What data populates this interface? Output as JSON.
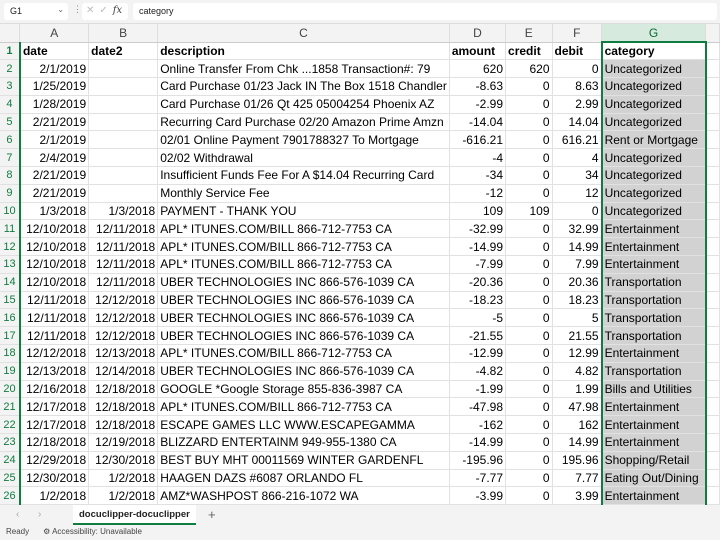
{
  "formula_bar": {
    "name_box": "G1",
    "formula": "category"
  },
  "columns": [
    "A",
    "B",
    "C",
    "D",
    "E",
    "F",
    "G"
  ],
  "rows": [
    [
      "date",
      "date2",
      "description",
      "amount",
      "credit",
      "debit",
      "category"
    ],
    [
      "2/1/2019",
      "",
      "Online Transfer From Chk ...1858 Transaction#: 79",
      "620",
      "620",
      "0",
      "Uncategorized"
    ],
    [
      "1/25/2019",
      "",
      "Card Purchase 01/23 Jack IN The Box 1518 Chandler",
      "-8.63",
      "0",
      "8.63",
      "Uncategorized"
    ],
    [
      "1/28/2019",
      "",
      "Card Purchase 01/26 Qt 425 05004254 Phoenix AZ",
      "-2.99",
      "0",
      "2.99",
      "Uncategorized"
    ],
    [
      "2/21/2019",
      "",
      "Recurring Card Purchase 02/20 Amazon Prime Amzn",
      "-14.04",
      "0",
      "14.04",
      "Uncategorized"
    ],
    [
      "2/1/2019",
      "",
      "02/01 Online Payment 7901788327 To Mortgage",
      "-616.21",
      "0",
      "616.21",
      "Rent or Mortgage"
    ],
    [
      "2/4/2019",
      "",
      "02/02 Withdrawal",
      "-4",
      "0",
      "4",
      "Uncategorized"
    ],
    [
      "2/21/2019",
      "",
      "Insufficient Funds Fee For A $14.04 Recurring Card",
      "-34",
      "0",
      "34",
      "Uncategorized"
    ],
    [
      "2/21/2019",
      "",
      "Monthly Service Fee",
      "-12",
      "0",
      "12",
      "Uncategorized"
    ],
    [
      "1/3/2018",
      "1/3/2018",
      "PAYMENT - THANK YOU",
      "109",
      "109",
      "0",
      "Uncategorized"
    ],
    [
      "12/10/2018",
      "12/11/2018",
      "APL* ITUNES.COM/BILL 866-712-7753 CA",
      "-32.99",
      "0",
      "32.99",
      "Entertainment"
    ],
    [
      "12/10/2018",
      "12/11/2018",
      "APL* ITUNES.COM/BILL 866-712-7753 CA",
      "-14.99",
      "0",
      "14.99",
      "Entertainment"
    ],
    [
      "12/10/2018",
      "12/11/2018",
      "APL* ITUNES.COM/BILL 866-712-7753 CA",
      "-7.99",
      "0",
      "7.99",
      "Entertainment"
    ],
    [
      "12/10/2018",
      "12/11/2018",
      "UBER TECHNOLOGIES INC 866-576-1039 CA",
      "-20.36",
      "0",
      "20.36",
      "Transportation"
    ],
    [
      "12/11/2018",
      "12/12/2018",
      "UBER TECHNOLOGIES INC 866-576-1039 CA",
      "-18.23",
      "0",
      "18.23",
      "Transportation"
    ],
    [
      "12/11/2018",
      "12/12/2018",
      "UBER TECHNOLOGIES INC 866-576-1039 CA",
      "-5",
      "0",
      "5",
      "Transportation"
    ],
    [
      "12/11/2018",
      "12/12/2018",
      "UBER TECHNOLOGIES INC 866-576-1039 CA",
      "-21.55",
      "0",
      "21.55",
      "Transportation"
    ],
    [
      "12/12/2018",
      "12/13/2018",
      "APL* ITUNES.COM/BILL 866-712-7753 CA",
      "-12.99",
      "0",
      "12.99",
      "Entertainment"
    ],
    [
      "12/13/2018",
      "12/14/2018",
      "UBER TECHNOLOGIES INC 866-576-1039 CA",
      "-4.82",
      "0",
      "4.82",
      "Transportation"
    ],
    [
      "12/16/2018",
      "12/18/2018",
      "GOOGLE *Google Storage 855-836-3987 CA",
      "-1.99",
      "0",
      "1.99",
      "Bills and Utilities"
    ],
    [
      "12/17/2018",
      "12/18/2018",
      "APL* ITUNES.COM/BILL 866-712-7753 CA",
      "-47.98",
      "0",
      "47.98",
      "Entertainment"
    ],
    [
      "12/17/2018",
      "12/18/2018",
      "ESCAPE GAMES LLC WWW.ESCAPEGAMMA",
      "-162",
      "0",
      "162",
      "Entertainment"
    ],
    [
      "12/18/2018",
      "12/19/2018",
      "BLIZZARD ENTERTAINM 949-955-1380 CA",
      "-14.99",
      "0",
      "14.99",
      "Entertainment"
    ],
    [
      "12/29/2018",
      "12/30/2018",
      "BEST BUY MHT 00011569 WINTER GARDENFL",
      "-195.96",
      "0",
      "195.96",
      "Shopping/Retail"
    ],
    [
      "12/30/2018",
      "1/2/2018",
      "HAAGEN DAZS #6087 ORLANDO FL",
      "-7.77",
      "0",
      "7.77",
      "Eating Out/Dining"
    ],
    [
      "1/2/2018",
      "1/2/2018",
      "AMZ*WASHPOST 866-216-1072 WA",
      "-3.99",
      "0",
      "3.99",
      "Entertainment"
    ]
  ],
  "sheet_tab": "docuclipper-docuclipper",
  "status": {
    "ready": "Ready",
    "accessibility": "Accessibility: Unavailable"
  }
}
